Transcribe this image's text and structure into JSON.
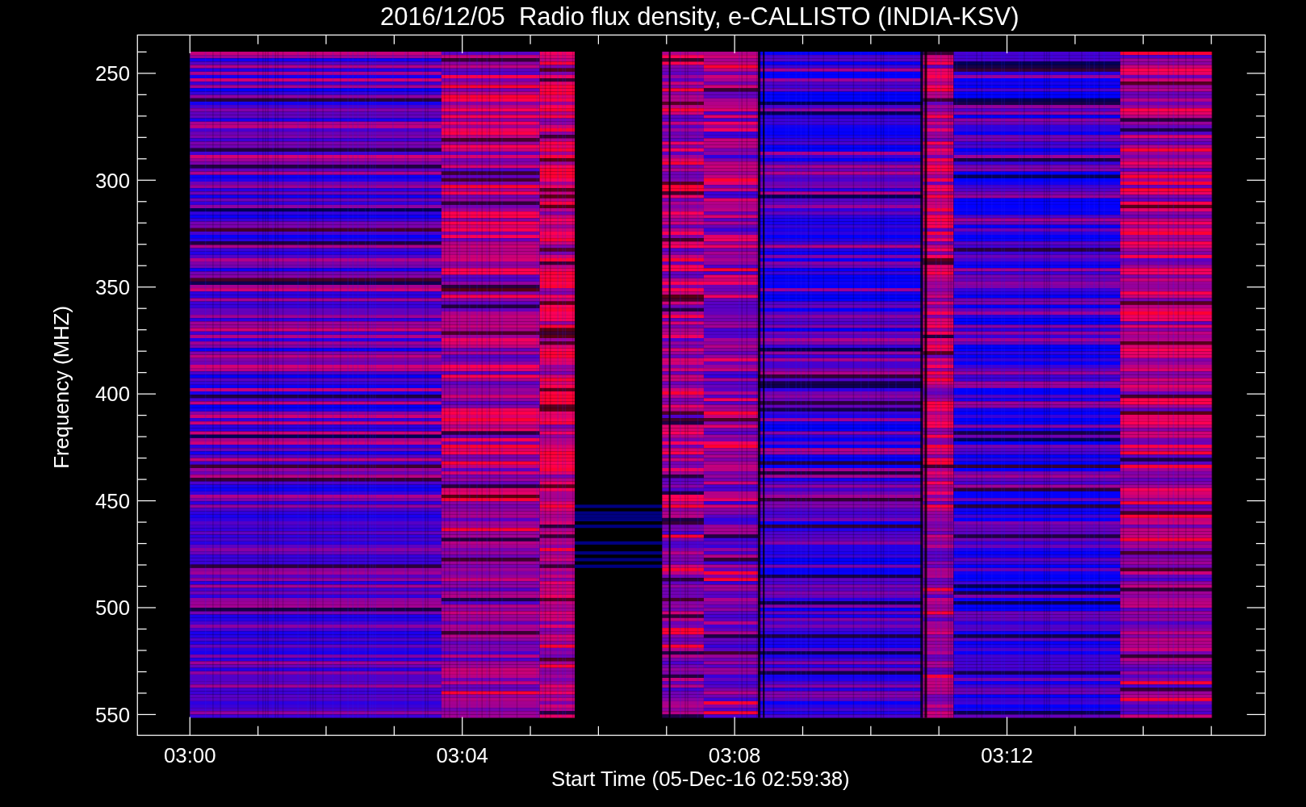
{
  "title": "2016/12/05  Radio flux density, e-CALLISTO (INDIA-KSV)",
  "y_axis": {
    "label": "Frequency (MHZ)",
    "ticks": [
      "250",
      "300",
      "350",
      "400",
      "450",
      "500",
      "550"
    ]
  },
  "x_axis": {
    "label": "Start Time (05-Dec-16 02:59:38)",
    "ticks": [
      "03:00",
      "03:04",
      "03:08",
      "03:12"
    ]
  }
}
